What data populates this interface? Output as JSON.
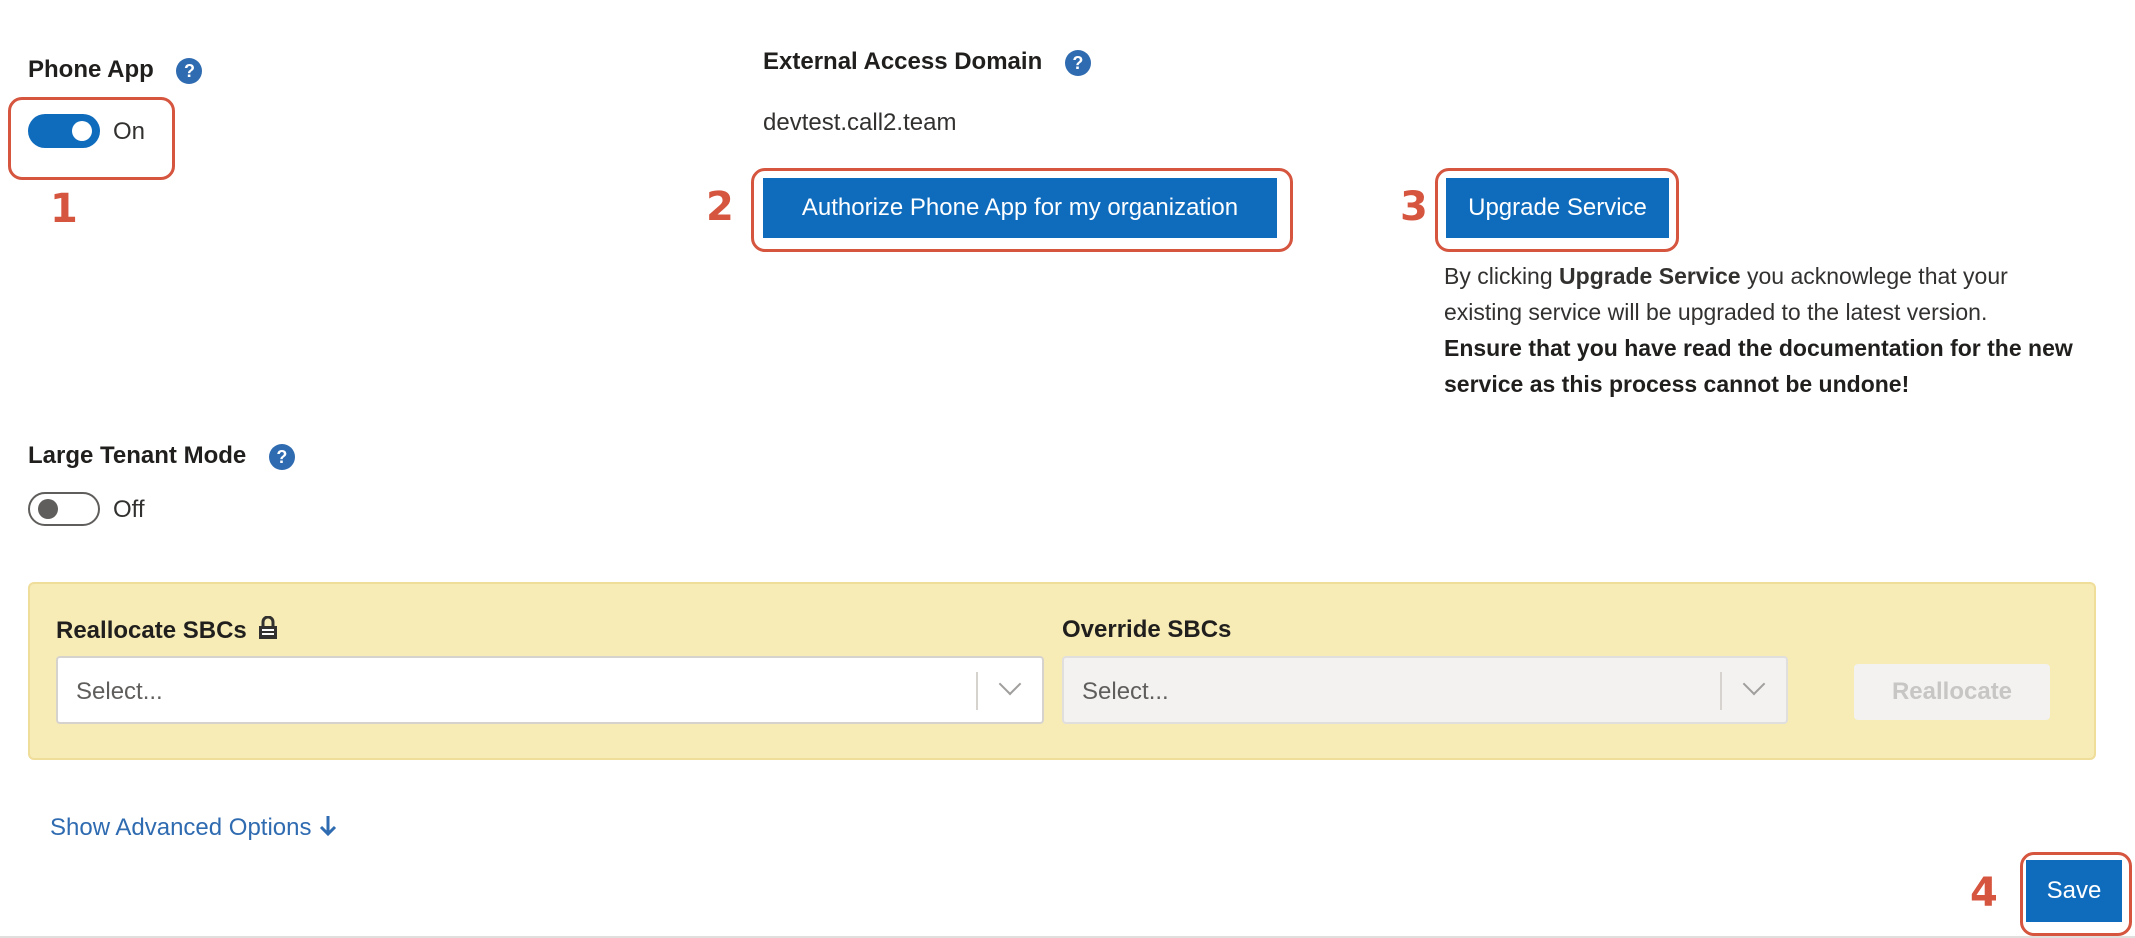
{
  "phone_app": {
    "label": "Phone App",
    "help": "?",
    "toggle_state": "On"
  },
  "external_access": {
    "label": "External Access Domain",
    "help": "?",
    "value": "devtest.call2.team"
  },
  "buttons": {
    "authorize": "Authorize Phone App for my organization",
    "upgrade": "Upgrade Service",
    "reallocate": "Reallocate",
    "save": "Save"
  },
  "upgrade_notice": {
    "prefix": "By clicking ",
    "bold_name": "Upgrade Service",
    "suffix": " you acknowlege that your existing service will be upgraded to the latest version.",
    "warning": "Ensure that you have read the documentation for the new service as this process cannot be undone!"
  },
  "large_tenant": {
    "label": "Large Tenant Mode",
    "help": "?",
    "toggle_state": "Off"
  },
  "sbc_panel": {
    "reallocate_label": "Reallocate SBCs",
    "reallocate_icon": "lock-icon",
    "override_label": "Override SBCs",
    "reallocate_placeholder": "Select...",
    "override_placeholder": "Select..."
  },
  "advanced_link": {
    "label": "Show Advanced Options",
    "icon": "arrow-down-icon"
  },
  "annotations": [
    "1",
    "2",
    "3",
    "4"
  ],
  "colors": {
    "primary": "#0f6cbd",
    "annotation": "#d5553f",
    "panel": "#f7ebb6",
    "link": "#2f6bb0"
  }
}
